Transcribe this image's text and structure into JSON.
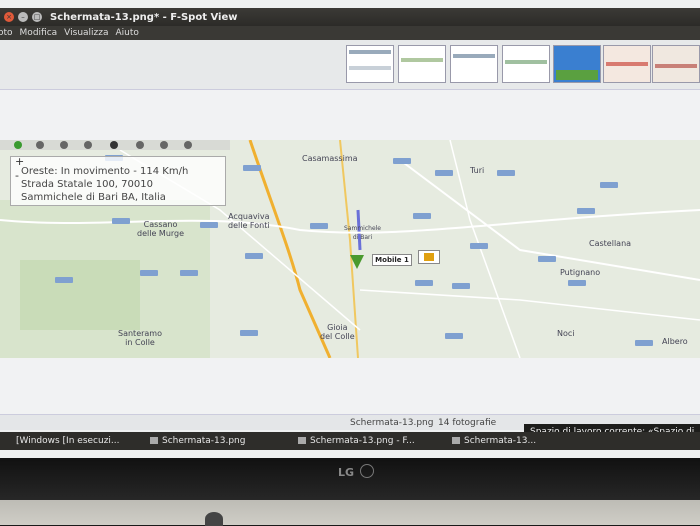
{
  "window": {
    "title": "Schermata-13.png* - F-Spot View",
    "buttons": {
      "close": "×",
      "min": "–",
      "max": "□"
    }
  },
  "menu": {
    "items": [
      "oto",
      "Modifica",
      "Visualizza",
      "Aiuto"
    ]
  },
  "map": {
    "info": {
      "line1": "Oreste:  In movimento - 114 Km/h",
      "line2": "Strada Statale 100, 70010",
      "line3": "Sammichele di Bari BA, Italia",
      "zoom_in": "+",
      "zoom_out": "-"
    },
    "marker_label": "Mobile 1",
    "towns": {
      "casamassima": "Casamassima",
      "turi": "Turi",
      "cassano": "Cassano\ndelle Murge",
      "acquaviva": "Acquaviva\ndelle Fonti",
      "sammichele": "Sammichele\ndi Bari",
      "castellana": "Castellana",
      "putignano": "Putignano",
      "santeramo": "Santeramo\nin Colle",
      "gioia": "Gioia\ndel Colle",
      "noci": "Noci",
      "alberobello": "Albero"
    }
  },
  "statusbar": {
    "file": "Schermata-13.png",
    "count": "14 fotografie"
  },
  "tooltip": "Spazio di lavoro corrente: «Spazio di",
  "taskbar": {
    "items": [
      "[Windows [In esecuzi...",
      "Schermata-13.png",
      "Schermata-13.png - F...",
      "Schermata-13..."
    ]
  },
  "monitor": {
    "brand": "LG"
  },
  "colors": {
    "marker": "#4a9a2e",
    "road": "#f0b030",
    "shield": "#7fa0d0"
  }
}
